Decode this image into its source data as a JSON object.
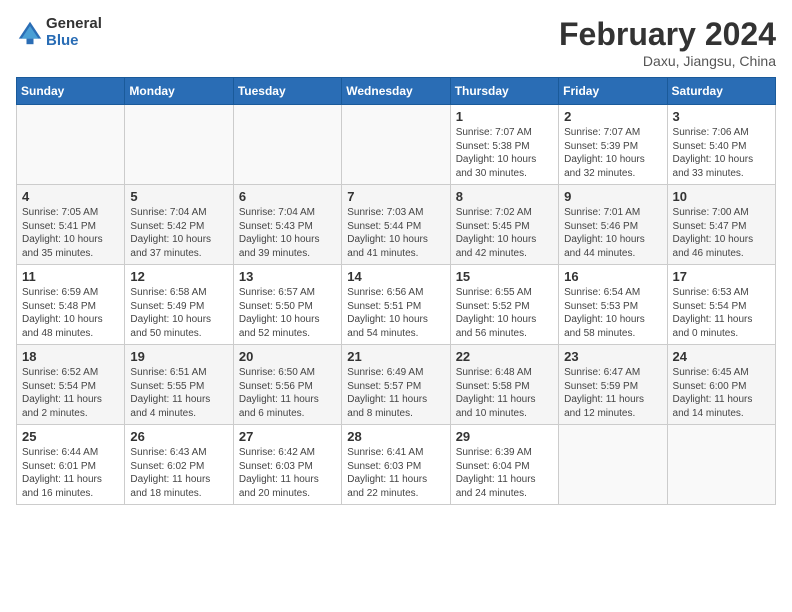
{
  "header": {
    "logo_general": "General",
    "logo_blue": "Blue",
    "month_title": "February 2024",
    "location": "Daxu, Jiangsu, China"
  },
  "weekdays": [
    "Sunday",
    "Monday",
    "Tuesday",
    "Wednesday",
    "Thursday",
    "Friday",
    "Saturday"
  ],
  "weeks": [
    [
      {
        "day": "",
        "info": ""
      },
      {
        "day": "",
        "info": ""
      },
      {
        "day": "",
        "info": ""
      },
      {
        "day": "",
        "info": ""
      },
      {
        "day": "1",
        "info": "Sunrise: 7:07 AM\nSunset: 5:38 PM\nDaylight: 10 hours\nand 30 minutes."
      },
      {
        "day": "2",
        "info": "Sunrise: 7:07 AM\nSunset: 5:39 PM\nDaylight: 10 hours\nand 32 minutes."
      },
      {
        "day": "3",
        "info": "Sunrise: 7:06 AM\nSunset: 5:40 PM\nDaylight: 10 hours\nand 33 minutes."
      }
    ],
    [
      {
        "day": "4",
        "info": "Sunrise: 7:05 AM\nSunset: 5:41 PM\nDaylight: 10 hours\nand 35 minutes."
      },
      {
        "day": "5",
        "info": "Sunrise: 7:04 AM\nSunset: 5:42 PM\nDaylight: 10 hours\nand 37 minutes."
      },
      {
        "day": "6",
        "info": "Sunrise: 7:04 AM\nSunset: 5:43 PM\nDaylight: 10 hours\nand 39 minutes."
      },
      {
        "day": "7",
        "info": "Sunrise: 7:03 AM\nSunset: 5:44 PM\nDaylight: 10 hours\nand 41 minutes."
      },
      {
        "day": "8",
        "info": "Sunrise: 7:02 AM\nSunset: 5:45 PM\nDaylight: 10 hours\nand 42 minutes."
      },
      {
        "day": "9",
        "info": "Sunrise: 7:01 AM\nSunset: 5:46 PM\nDaylight: 10 hours\nand 44 minutes."
      },
      {
        "day": "10",
        "info": "Sunrise: 7:00 AM\nSunset: 5:47 PM\nDaylight: 10 hours\nand 46 minutes."
      }
    ],
    [
      {
        "day": "11",
        "info": "Sunrise: 6:59 AM\nSunset: 5:48 PM\nDaylight: 10 hours\nand 48 minutes."
      },
      {
        "day": "12",
        "info": "Sunrise: 6:58 AM\nSunset: 5:49 PM\nDaylight: 10 hours\nand 50 minutes."
      },
      {
        "day": "13",
        "info": "Sunrise: 6:57 AM\nSunset: 5:50 PM\nDaylight: 10 hours\nand 52 minutes."
      },
      {
        "day": "14",
        "info": "Sunrise: 6:56 AM\nSunset: 5:51 PM\nDaylight: 10 hours\nand 54 minutes."
      },
      {
        "day": "15",
        "info": "Sunrise: 6:55 AM\nSunset: 5:52 PM\nDaylight: 10 hours\nand 56 minutes."
      },
      {
        "day": "16",
        "info": "Sunrise: 6:54 AM\nSunset: 5:53 PM\nDaylight: 10 hours\nand 58 minutes."
      },
      {
        "day": "17",
        "info": "Sunrise: 6:53 AM\nSunset: 5:54 PM\nDaylight: 11 hours\nand 0 minutes."
      }
    ],
    [
      {
        "day": "18",
        "info": "Sunrise: 6:52 AM\nSunset: 5:54 PM\nDaylight: 11 hours\nand 2 minutes."
      },
      {
        "day": "19",
        "info": "Sunrise: 6:51 AM\nSunset: 5:55 PM\nDaylight: 11 hours\nand 4 minutes."
      },
      {
        "day": "20",
        "info": "Sunrise: 6:50 AM\nSunset: 5:56 PM\nDaylight: 11 hours\nand 6 minutes."
      },
      {
        "day": "21",
        "info": "Sunrise: 6:49 AM\nSunset: 5:57 PM\nDaylight: 11 hours\nand 8 minutes."
      },
      {
        "day": "22",
        "info": "Sunrise: 6:48 AM\nSunset: 5:58 PM\nDaylight: 11 hours\nand 10 minutes."
      },
      {
        "day": "23",
        "info": "Sunrise: 6:47 AM\nSunset: 5:59 PM\nDaylight: 11 hours\nand 12 minutes."
      },
      {
        "day": "24",
        "info": "Sunrise: 6:45 AM\nSunset: 6:00 PM\nDaylight: 11 hours\nand 14 minutes."
      }
    ],
    [
      {
        "day": "25",
        "info": "Sunrise: 6:44 AM\nSunset: 6:01 PM\nDaylight: 11 hours\nand 16 minutes."
      },
      {
        "day": "26",
        "info": "Sunrise: 6:43 AM\nSunset: 6:02 PM\nDaylight: 11 hours\nand 18 minutes."
      },
      {
        "day": "27",
        "info": "Sunrise: 6:42 AM\nSunset: 6:03 PM\nDaylight: 11 hours\nand 20 minutes."
      },
      {
        "day": "28",
        "info": "Sunrise: 6:41 AM\nSunset: 6:03 PM\nDaylight: 11 hours\nand 22 minutes."
      },
      {
        "day": "29",
        "info": "Sunrise: 6:39 AM\nSunset: 6:04 PM\nDaylight: 11 hours\nand 24 minutes."
      },
      {
        "day": "",
        "info": ""
      },
      {
        "day": "",
        "info": ""
      }
    ]
  ]
}
